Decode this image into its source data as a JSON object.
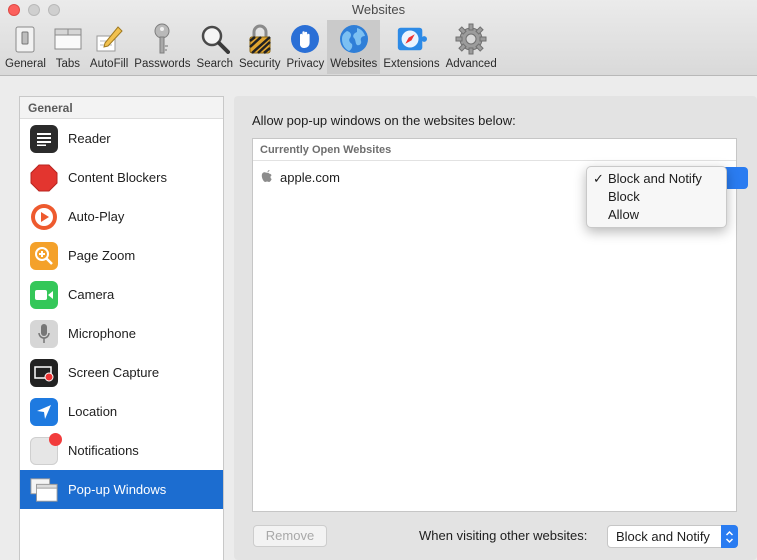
{
  "window": {
    "title": "Websites"
  },
  "toolbar": {
    "items": [
      {
        "label": "General",
        "icon": "general-switch-icon"
      },
      {
        "label": "Tabs",
        "icon": "tabs-icon"
      },
      {
        "label": "AutoFill",
        "icon": "autofill-pencil-icon"
      },
      {
        "label": "Passwords",
        "icon": "key-icon"
      },
      {
        "label": "Search",
        "icon": "magnifier-icon"
      },
      {
        "label": "Security",
        "icon": "padlock-icon"
      },
      {
        "label": "Privacy",
        "icon": "hand-icon"
      },
      {
        "label": "Websites",
        "icon": "globe-icon",
        "selected": true
      },
      {
        "label": "Extensions",
        "icon": "puzzle-compass-icon"
      },
      {
        "label": "Advanced",
        "icon": "gear-icon"
      }
    ]
  },
  "sidebar": {
    "header": "General",
    "items": [
      {
        "label": "Reader",
        "icon": "reader-icon"
      },
      {
        "label": "Content Blockers",
        "icon": "stop-sign-icon"
      },
      {
        "label": "Auto-Play",
        "icon": "play-icon"
      },
      {
        "label": "Page Zoom",
        "icon": "zoom-icon"
      },
      {
        "label": "Camera",
        "icon": "camera-icon"
      },
      {
        "label": "Microphone",
        "icon": "microphone-icon"
      },
      {
        "label": "Screen Capture",
        "icon": "screen-capture-icon"
      },
      {
        "label": "Location",
        "icon": "location-arrow-icon"
      },
      {
        "label": "Notifications",
        "icon": "notification-badge-icon"
      },
      {
        "label": "Pop-up Windows",
        "icon": "popup-windows-icon",
        "selected": true
      }
    ]
  },
  "main": {
    "prompt": "Allow pop-up windows on the websites below:",
    "table_header": "Currently Open Websites",
    "rows": [
      {
        "site": "apple.com",
        "icon": "apple-icon",
        "setting": "Block and Notify"
      }
    ],
    "menu": {
      "options": [
        "Block and Notify",
        "Block",
        "Allow"
      ],
      "checked": "Block and Notify",
      "check_glyph": "✓"
    },
    "remove_label": "Remove",
    "other_label": "When visiting other websites:",
    "other_value": "Block and Notify"
  },
  "colors": {
    "accent": "#2a7cf1",
    "selection": "#1c6dd0",
    "close": "#fc605c"
  }
}
